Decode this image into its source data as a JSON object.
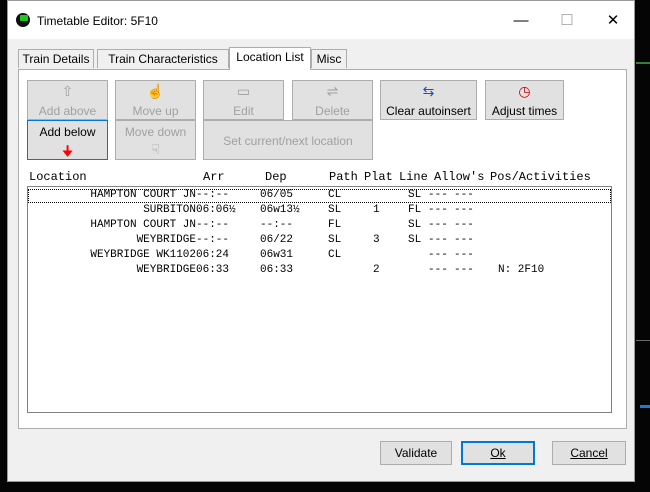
{
  "window": {
    "title": "Timetable Editor: 5F10",
    "minimize": "—",
    "maximize": "☐",
    "close": "✕"
  },
  "tabs": [
    {
      "label": "Train Details"
    },
    {
      "label": "Train Characteristics"
    },
    {
      "label": "Location List",
      "active": true
    },
    {
      "label": "Misc"
    }
  ],
  "toolbar": {
    "add_above": "Add above",
    "move_up": "Move up",
    "edit": "Edit",
    "delete": "Delete",
    "clear_autoinsert": "Clear autoinsert",
    "adjust_times": "Adjust times",
    "add_below": "Add below",
    "move_down": "Move down",
    "set_current_next": "Set current/next location"
  },
  "columns": {
    "location": "Location",
    "arr": "Arr",
    "dep": "Dep",
    "path": "Path",
    "plat": "Plat",
    "line": "Line",
    "allows": "Allow's",
    "pos": "Pos/Activities"
  },
  "rows": [
    {
      "location": "HAMPTON COURT JN",
      "arr": "--:--",
      "dep": "06/05",
      "path": "CL",
      "plat": "",
      "line": "SL",
      "allow1": "---",
      "allow2": "---",
      "pos": ""
    },
    {
      "location": "SURBITON",
      "arr": "06:06½",
      "dep": "06w13½",
      "path": "SL",
      "plat": "1",
      "line": "FL",
      "allow1": "---",
      "allow2": "---",
      "pos": ""
    },
    {
      "location": "HAMPTON COURT JN",
      "arr": "--:--",
      "dep": "--:--",
      "path": "FL",
      "plat": "",
      "line": "SL",
      "allow1": "---",
      "allow2": "---",
      "pos": ""
    },
    {
      "location": "WEYBRIDGE",
      "arr": "--:--",
      "dep": "06/22",
      "path": "SL",
      "plat": "3",
      "line": "SL",
      "allow1": "---",
      "allow2": "---",
      "pos": ""
    },
    {
      "location": "WEYBRIDGE WK1102",
      "arr": "06:24",
      "dep": "06w31",
      "path": "CL",
      "plat": "",
      "line": "",
      "allow1": "---",
      "allow2": "---",
      "pos": ""
    },
    {
      "location": "WEYBRIDGE",
      "arr": "06:33",
      "dep": "06:33",
      "path": "",
      "plat": "2",
      "line": "",
      "allow1": "---",
      "allow2": "---",
      "pos": "N: 2F10"
    }
  ],
  "footer": {
    "validate": "Validate",
    "ok": "Ok",
    "cancel": "Cancel"
  },
  "colors": {
    "window_bg": "#f0f0f0",
    "button_bg": "#e1e1e1",
    "default_border": "#0078d7",
    "arrow_red": "#ff0000"
  }
}
